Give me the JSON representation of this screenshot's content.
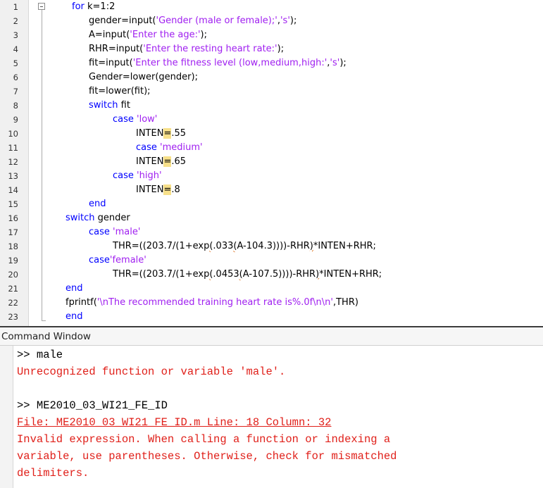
{
  "editor": {
    "line_numbers": [
      "1",
      "2",
      "3",
      "4",
      "5",
      "6",
      "7",
      "8",
      "9",
      "10",
      "11",
      "12",
      "13",
      "14",
      "15",
      "16",
      "17",
      "18",
      "19",
      "20",
      "21",
      "22",
      "23"
    ],
    "lines": [
      {
        "n": "1",
        "indent": 102,
        "segs": [
          {
            "t": "for",
            "c": "kw"
          },
          {
            "t": " k=1:2",
            "c": ""
          }
        ]
      },
      {
        "n": "2",
        "indent": 126,
        "segs": [
          {
            "t": "gender=input(",
            "c": ""
          },
          {
            "t": "'Gender (male or female);'",
            "c": "str"
          },
          {
            "t": ",",
            "c": ""
          },
          {
            "t": "'s'",
            "c": "str"
          },
          {
            "t": ");",
            "c": ""
          }
        ]
      },
      {
        "n": "3",
        "indent": 126,
        "segs": [
          {
            "t": "A=input(",
            "c": ""
          },
          {
            "t": "'Enter the age:'",
            "c": "str"
          },
          {
            "t": ");",
            "c": ""
          }
        ]
      },
      {
        "n": "4",
        "indent": 126,
        "segs": [
          {
            "t": "RHR=input(",
            "c": ""
          },
          {
            "t": "'Enter the resting heart rate:'",
            "c": "str"
          },
          {
            "t": ");",
            "c": ""
          }
        ]
      },
      {
        "n": "5",
        "indent": 126,
        "segs": [
          {
            "t": "fit=input(",
            "c": ""
          },
          {
            "t": "'Enter the fitness level (low,medium,high:'",
            "c": "str"
          },
          {
            "t": ",",
            "c": ""
          },
          {
            "t": "'s'",
            "c": "str"
          },
          {
            "t": ");",
            "c": ""
          }
        ]
      },
      {
        "n": "6",
        "indent": 126,
        "segs": [
          {
            "t": "Gender=lower(gender);",
            "c": ""
          }
        ]
      },
      {
        "n": "7",
        "indent": 126,
        "segs": [
          {
            "t": "fit=lower(fit);",
            "c": ""
          }
        ]
      },
      {
        "n": "8",
        "indent": 126,
        "segs": [
          {
            "t": "switch",
            "c": "kw"
          },
          {
            "t": " fit",
            "c": ""
          }
        ]
      },
      {
        "n": "9",
        "indent": 160,
        "segs": [
          {
            "t": "case",
            "c": "kw"
          },
          {
            "t": " ",
            "c": ""
          },
          {
            "t": "'low'",
            "c": "str"
          }
        ]
      },
      {
        "n": "10",
        "indent": 193,
        "segs": [
          {
            "t": "INTEN",
            "c": ""
          },
          {
            "t": "=",
            "c": "hl"
          },
          {
            "t": ".55",
            "c": ""
          }
        ]
      },
      {
        "n": "11",
        "indent": 193,
        "segs": [
          {
            "t": "case",
            "c": "kw"
          },
          {
            "t": " ",
            "c": ""
          },
          {
            "t": "'medium'",
            "c": "str"
          }
        ]
      },
      {
        "n": "12",
        "indent": 193,
        "segs": [
          {
            "t": "INTEN",
            "c": ""
          },
          {
            "t": "=",
            "c": "hl"
          },
          {
            "t": ".65",
            "c": ""
          }
        ]
      },
      {
        "n": "13",
        "indent": 160,
        "segs": [
          {
            "t": "case",
            "c": "kw"
          },
          {
            "t": " ",
            "c": ""
          },
          {
            "t": "'high'",
            "c": "str"
          }
        ]
      },
      {
        "n": "14",
        "indent": 193,
        "segs": [
          {
            "t": "INTEN",
            "c": ""
          },
          {
            "t": "=",
            "c": "hl"
          },
          {
            "t": ".8",
            "c": ""
          }
        ]
      },
      {
        "n": "15",
        "indent": 126,
        "segs": [
          {
            "t": "end",
            "c": "kw"
          }
        ]
      },
      {
        "n": "16",
        "indent": 93,
        "segs": [
          {
            "t": "switch",
            "c": "kw"
          },
          {
            "t": " gender",
            "c": ""
          }
        ]
      },
      {
        "n": "17",
        "indent": 126,
        "segs": [
          {
            "t": "case",
            "c": "kw"
          },
          {
            "t": " ",
            "c": ""
          },
          {
            "t": "'male'",
            "c": "str"
          }
        ]
      },
      {
        "n": "18",
        "indent": 160,
        "segs": [
          {
            "t": "THR=((203.7/(1+exp",
            "c": ""
          },
          {
            "t": "(",
            "c": "squig"
          },
          {
            "t": ".033",
            "c": ""
          },
          {
            "t": "(",
            "c": "squig"
          },
          {
            "t": "A-104.3))))-RHR",
            "c": ""
          },
          {
            "t": ")",
            "c": "squig"
          },
          {
            "t": "*INTEN+RHR;",
            "c": ""
          }
        ]
      },
      {
        "n": "19",
        "indent": 126,
        "segs": [
          {
            "t": "case",
            "c": "kw"
          },
          {
            "t": "'female'",
            "c": "str"
          }
        ]
      },
      {
        "n": "20",
        "indent": 160,
        "segs": [
          {
            "t": "THR=((203.7/(1+exp",
            "c": ""
          },
          {
            "t": "(",
            "c": "squig"
          },
          {
            "t": ".0453",
            "c": ""
          },
          {
            "t": "(",
            "c": "squig"
          },
          {
            "t": "A-107.5))))-RHR",
            "c": ""
          },
          {
            "t": ")",
            "c": "squig"
          },
          {
            "t": "*INTEN+RHR;",
            "c": ""
          }
        ]
      },
      {
        "n": "21",
        "indent": 93,
        "segs": [
          {
            "t": "end",
            "c": "kw"
          }
        ]
      },
      {
        "n": "22",
        "indent": 93,
        "segs": [
          {
            "t": "fprintf(",
            "c": ""
          },
          {
            "t": "'\\nThe recommended training heart rate is%.0f\\n\\n'",
            "c": "str"
          },
          {
            "t": ",THR)",
            "c": ""
          }
        ]
      },
      {
        "n": "23",
        "indent": 93,
        "segs": [
          {
            "t": "end",
            "c": "kw"
          }
        ]
      }
    ]
  },
  "command_window": {
    "title": "Command Window",
    "lines": [
      {
        "t": ">> male",
        "c": "prompt"
      },
      {
        "t": "Unrecognized function or variable 'male'.",
        "c": "err"
      },
      {
        "t": "",
        "c": "prompt"
      },
      {
        "t": ">> ME2010_03_WI21_FE_ID",
        "c": "prompt"
      },
      {
        "t": "File: ME2010_03_WI21_FE_ID.m Line: 18 Column: 32",
        "c": "errlink"
      },
      {
        "t": "Invalid expression. When calling a function or indexing a",
        "c": "err"
      },
      {
        "t": "variable, use parentheses. Otherwise, check for mismatched",
        "c": "err"
      },
      {
        "t": "delimiters.",
        "c": "err"
      }
    ]
  },
  "colors": {
    "keyword": "#0000ff",
    "string": "#a020f0",
    "error": "#e0201a",
    "highlight": "#f7e08a"
  }
}
